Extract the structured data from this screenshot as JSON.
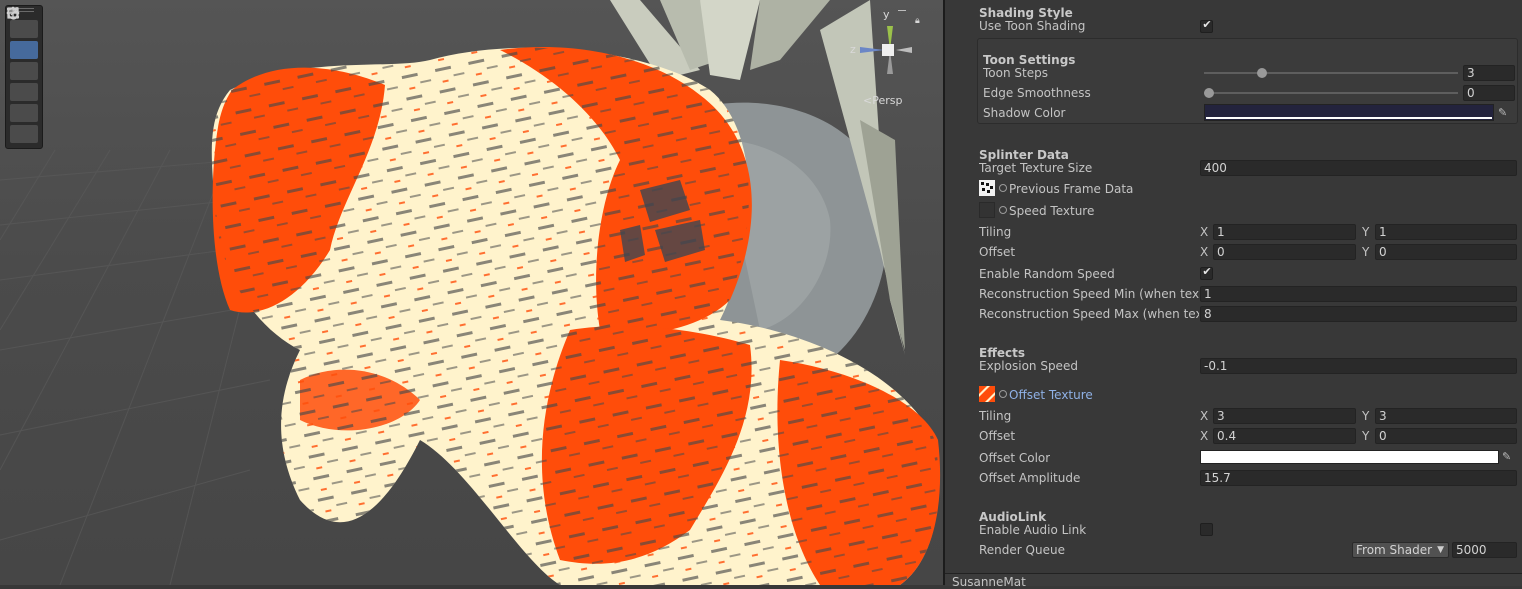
{
  "scene": {
    "view_label": "Persp",
    "axis_y": "y",
    "axis_z": "z",
    "colors": {
      "orange": "#ff4d0a",
      "cream": "#fff3cc",
      "background": "#4a4a4a",
      "spike": "#c9ccbe"
    },
    "tools": [
      {
        "name": "hand-icon"
      },
      {
        "name": "move-icon",
        "active": true
      },
      {
        "name": "rotate-icon"
      },
      {
        "name": "scale-icon"
      },
      {
        "name": "rect-icon"
      },
      {
        "name": "transform-icon"
      }
    ]
  },
  "inspector": {
    "shading_style": {
      "title": "Shading Style",
      "use_toon_label": "Use Toon Shading",
      "use_toon_checked": "✔"
    },
    "toon": {
      "title": "Toon Settings",
      "steps_label": "Toon Steps",
      "steps_value": "3",
      "steps_fraction": 0.23,
      "edge_label": "Edge Smoothness",
      "edge_value": "0",
      "edge_fraction": 0.0,
      "shadow_label": "Shadow Color",
      "shadow_color": "#23233d"
    },
    "splinter": {
      "title": "Splinter Data",
      "tex_size_label": "Target Texture Size",
      "tex_size_value": "400",
      "prev_frame_label": "Previous Frame Data",
      "speed_tex_label": "Speed Texture",
      "tiling_label": "Tiling",
      "tiling_x": "1",
      "tiling_y": "1",
      "offset_label": "Offset",
      "offset_x": "0",
      "offset_y": "0",
      "random_label": "Enable Random Speed",
      "random_checked": "✔",
      "min_label": "Reconstruction Speed Min (when textur",
      "min_value": "1",
      "max_label": "Reconstruction Speed Max (when textu",
      "max_value": "8"
    },
    "effects": {
      "title": "Effects",
      "explosion_label": "Explosion Speed",
      "explosion_value": "-0.1",
      "offset_tex_label": "Offset Texture",
      "tiling_label": "Tiling",
      "tiling_x": "3",
      "tiling_y": "3",
      "offset_label": "Offset",
      "offset_x": "0.4",
      "offset_y": "0",
      "offset_color_label": "Offset Color",
      "offset_color": "#ffffff",
      "amplitude_label": "Offset Amplitude",
      "amplitude_value": "15.7"
    },
    "audiolink": {
      "title": "AudioLink",
      "enable_label": "Enable Audio Link",
      "queue_label": "Render Queue",
      "queue_mode": "From Shader",
      "queue_value": "5000"
    },
    "axis_x": "X",
    "axis_y": "Y",
    "footer_material": "SusanneMat"
  }
}
